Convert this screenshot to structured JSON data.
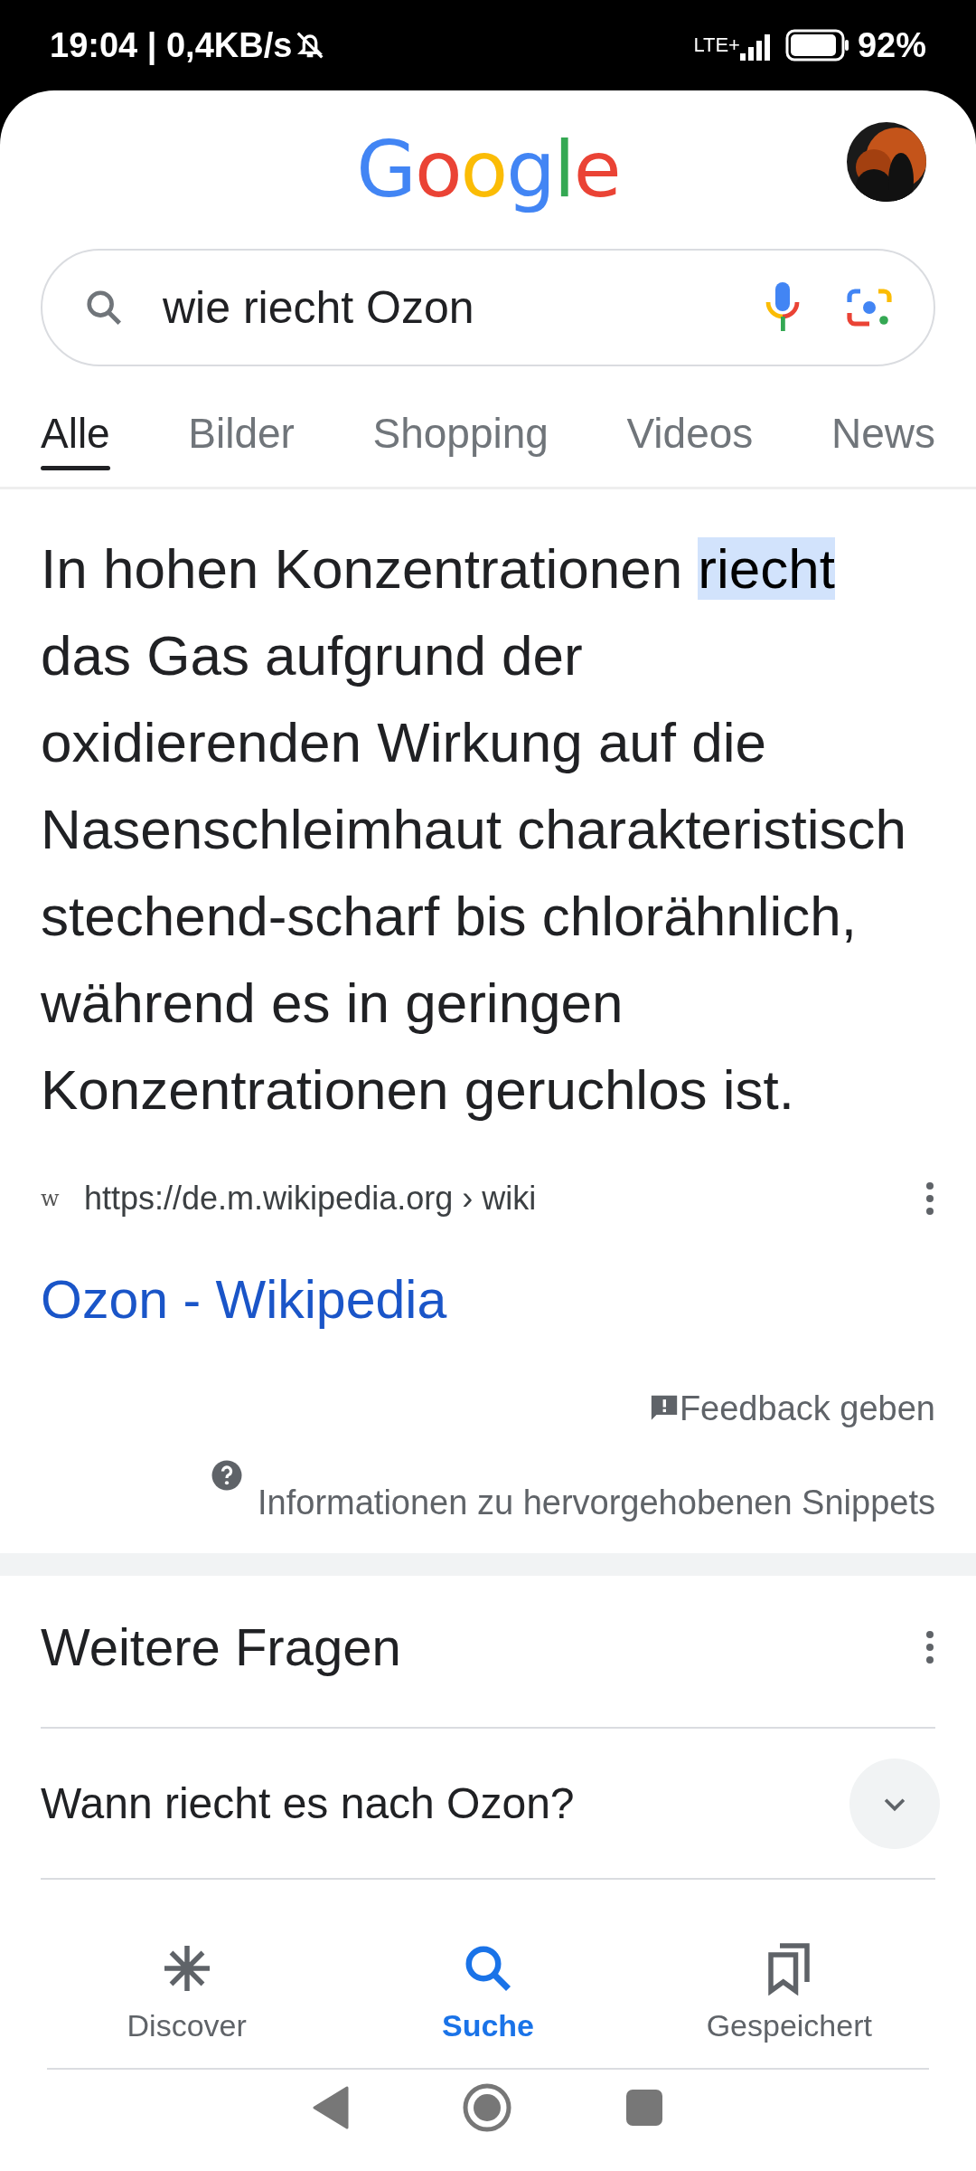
{
  "status_bar": {
    "time": "19:04 | 0,4KB/s",
    "network": "LTE+",
    "battery": "92%"
  },
  "header": {
    "logo": "Google"
  },
  "search": {
    "value": "wie riecht Ozon"
  },
  "tabs": [
    {
      "label": "Alle",
      "selected": true
    },
    {
      "label": "Bilder",
      "selected": false
    },
    {
      "label": "Shopping",
      "selected": false
    },
    {
      "label": "Videos",
      "selected": false
    },
    {
      "label": "News",
      "selected": false
    }
  ],
  "snippet": {
    "text": "In hohen Konzentrationen **riecht** das Gas aufgrund der oxidierenden Wirkung auf die Nasenschleimhaut charakteristisch stechend-scharf bis chlorähnlich, während es in geringen Konzentrationen geruchlos ist.",
    "favicon": "w",
    "url": "https://de.m.wikipedia.org › wiki",
    "title": "Ozon - Wikipedia",
    "feedback": "Feedback geben",
    "info": "Informationen zu hervorgehobenen Snippets"
  },
  "related": {
    "heading": "Weitere Fragen",
    "questions": [
      {
        "text": "Wann riecht es nach Ozon?",
        "expanded": false
      }
    ]
  },
  "bottom_nav": [
    {
      "label": "Discover",
      "selected": false
    },
    {
      "label": "Suche",
      "selected": true
    },
    {
      "label": "Gespeichert",
      "selected": false
    }
  ]
}
